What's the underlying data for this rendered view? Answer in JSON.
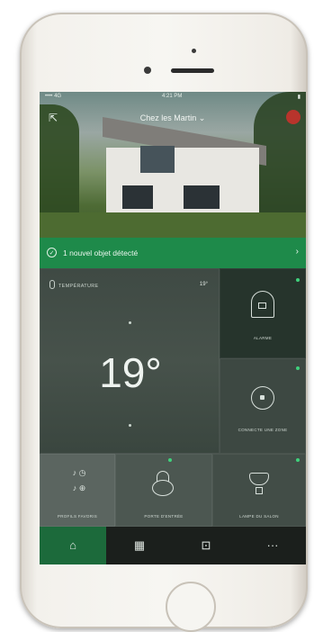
{
  "status": {
    "left": "•••• 4G",
    "time": "4:21 PM",
    "right": "▮"
  },
  "header": {
    "back_icon": "back-arrow-icon",
    "title": "Chez les Martin ⌄"
  },
  "notification": {
    "text": "1 nouvel objet détecté",
    "chevron": "›"
  },
  "tiles": {
    "temperature": {
      "label": "TEMPÉRATURE",
      "small": "19°",
      "value": "19°"
    },
    "alarm": {
      "label": "ALARME"
    },
    "switch": {
      "label": "CONNECTE UNE ZONE"
    },
    "scenes": {
      "label": "PROFILS FAVORIS",
      "glyphs": "♪ ◷\n♪ ⊕"
    },
    "lock": {
      "label": "PORTE D'ENTRÉE"
    },
    "lamp": {
      "label": "LAMPE DU SALON"
    }
  },
  "tabbar": {
    "home": "⌂",
    "grid": "▦",
    "device": "⊡",
    "more": "···"
  },
  "colors": {
    "accent": "#1e8a4a",
    "active_tab": "#1c6a3b",
    "indicator": "#3fd17c"
  }
}
